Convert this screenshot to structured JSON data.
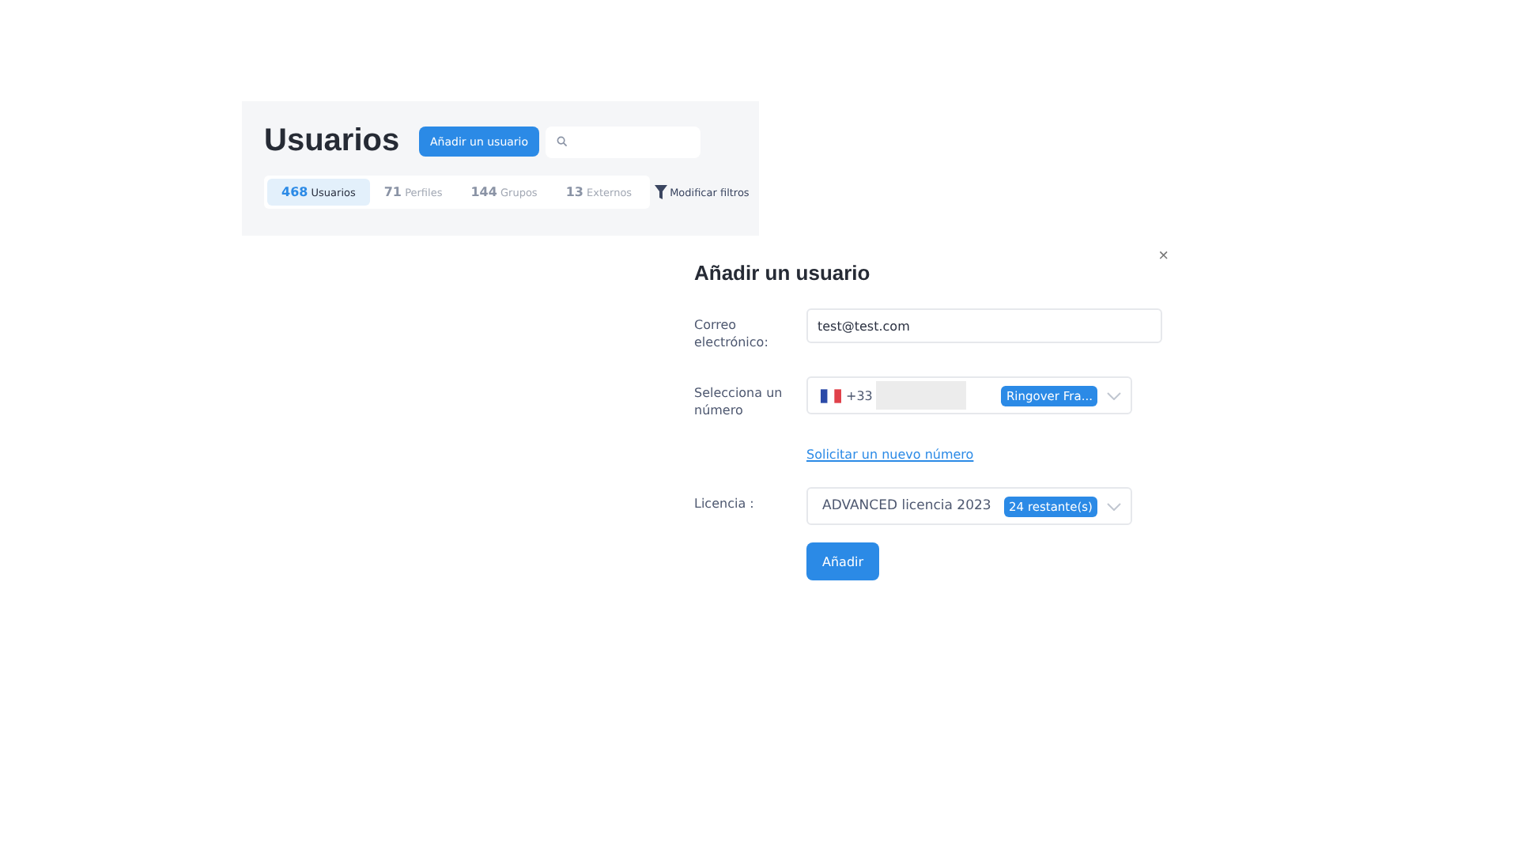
{
  "header": {
    "title": "Usuarios",
    "add_button": "Añadir un usuario"
  },
  "tabs": [
    {
      "count": "468",
      "label": "Usuarios",
      "selected": true
    },
    {
      "count": "71",
      "label": "Perfiles",
      "selected": false
    },
    {
      "count": "144",
      "label": "Grupos",
      "selected": false
    },
    {
      "count": "13",
      "label": "Externos",
      "selected": false
    }
  ],
  "filter_button": "Modificar filtros",
  "dialog": {
    "title": "Añadir un usuario",
    "close": "×",
    "email": {
      "label": "Correo electrónico:",
      "value": "test@test.com"
    },
    "number": {
      "label": "Selecciona un número",
      "prefix": "+33",
      "badge": "Ringover Fra..."
    },
    "request_link": "Solicitar un nuevo número",
    "license": {
      "label": "Licencia :",
      "value": "ADVANCED licencia 2023",
      "badge": "24 restante(s)"
    },
    "submit": "Añadir"
  }
}
